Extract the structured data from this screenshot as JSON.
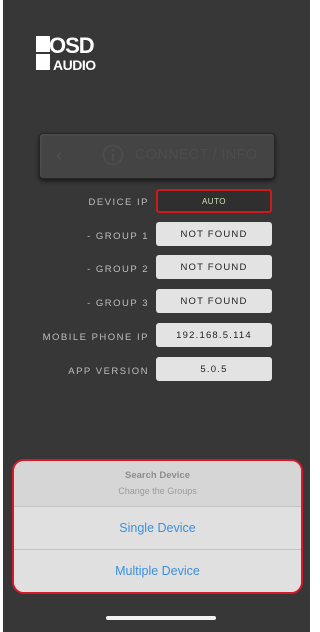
{
  "logo": {
    "line1": "OSD",
    "line2": "AUDIO"
  },
  "connect_bar": {
    "back_icon": "chevron-left-icon",
    "info_icon": "info-circle-icon",
    "title": "CONNECT / INFO"
  },
  "rows": [
    {
      "label": "DEVICE IP",
      "value": "AUTO"
    },
    {
      "label": "- GROUP 1",
      "value": "NOT FOUND"
    },
    {
      "label": "- GROUP 2",
      "value": "NOT FOUND"
    },
    {
      "label": "- GROUP 3",
      "value": "NOT FOUND"
    },
    {
      "label": "MOBILE PHONE IP",
      "value": "192.168.5.114"
    },
    {
      "label": "APP VERSION",
      "value": "5.0.5"
    }
  ],
  "action_sheet": {
    "title": "Search Device",
    "subtitle": "Change the Groups",
    "options": [
      "Single Device",
      "Multiple Device"
    ]
  },
  "colors": {
    "background": "#373737",
    "highlight_border": "#d8192a",
    "option_text": "#3b8fe2",
    "auto_text": "#cfe3b2"
  }
}
